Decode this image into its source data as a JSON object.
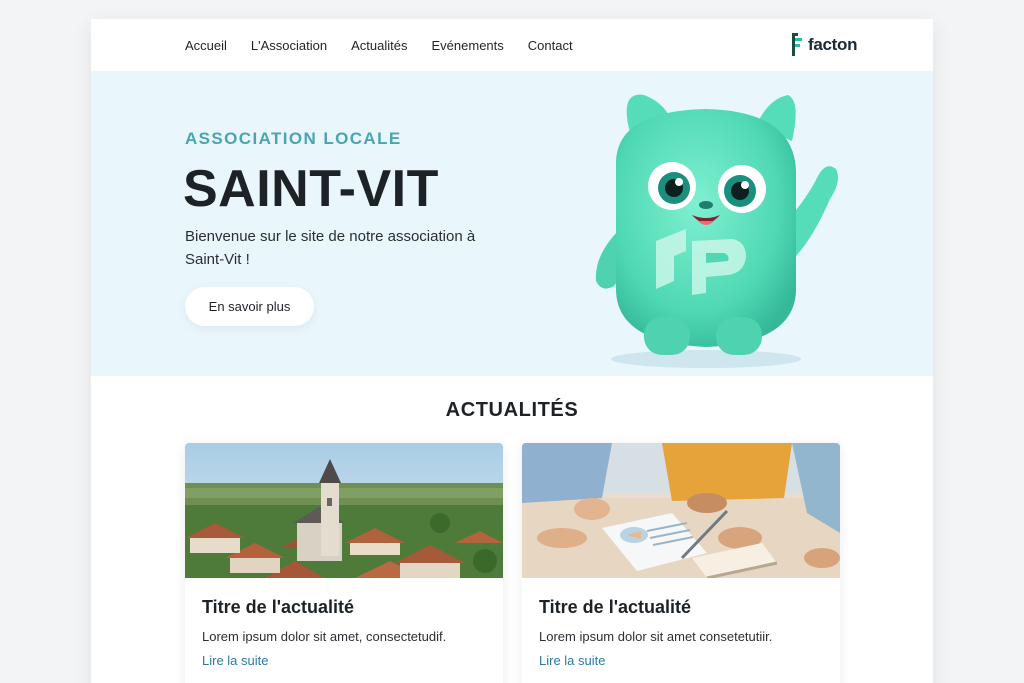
{
  "nav": {
    "items": [
      "Accueil",
      "L'Association",
      "Actualités",
      "Evénements",
      "Contact"
    ]
  },
  "logo": {
    "text": "facton"
  },
  "hero": {
    "eyebrow": "ASSOCIATION LOCALE",
    "title": "SAINT-VIT",
    "text": "Bienvenue sur le site de notre association à Saint-Vit !",
    "button": "En savoir plus"
  },
  "news": {
    "heading": "ACTUALITÉS",
    "cards": [
      {
        "title": "Titre de l'actualité",
        "text": "Lorem ipsum dolor sit amet, consectetudif.",
        "link": "Lire la suite"
      },
      {
        "title": "Titre de l'actualité",
        "text": "Lorem ipsum dolor sit amet consetetutiir.",
        "link": "Lire la suite"
      }
    ]
  },
  "colors": {
    "accent": "#4aa4b3",
    "hero_bg": "#e9f6fb",
    "mascot": "#4fd8b3",
    "link": "#2b7aa8"
  }
}
